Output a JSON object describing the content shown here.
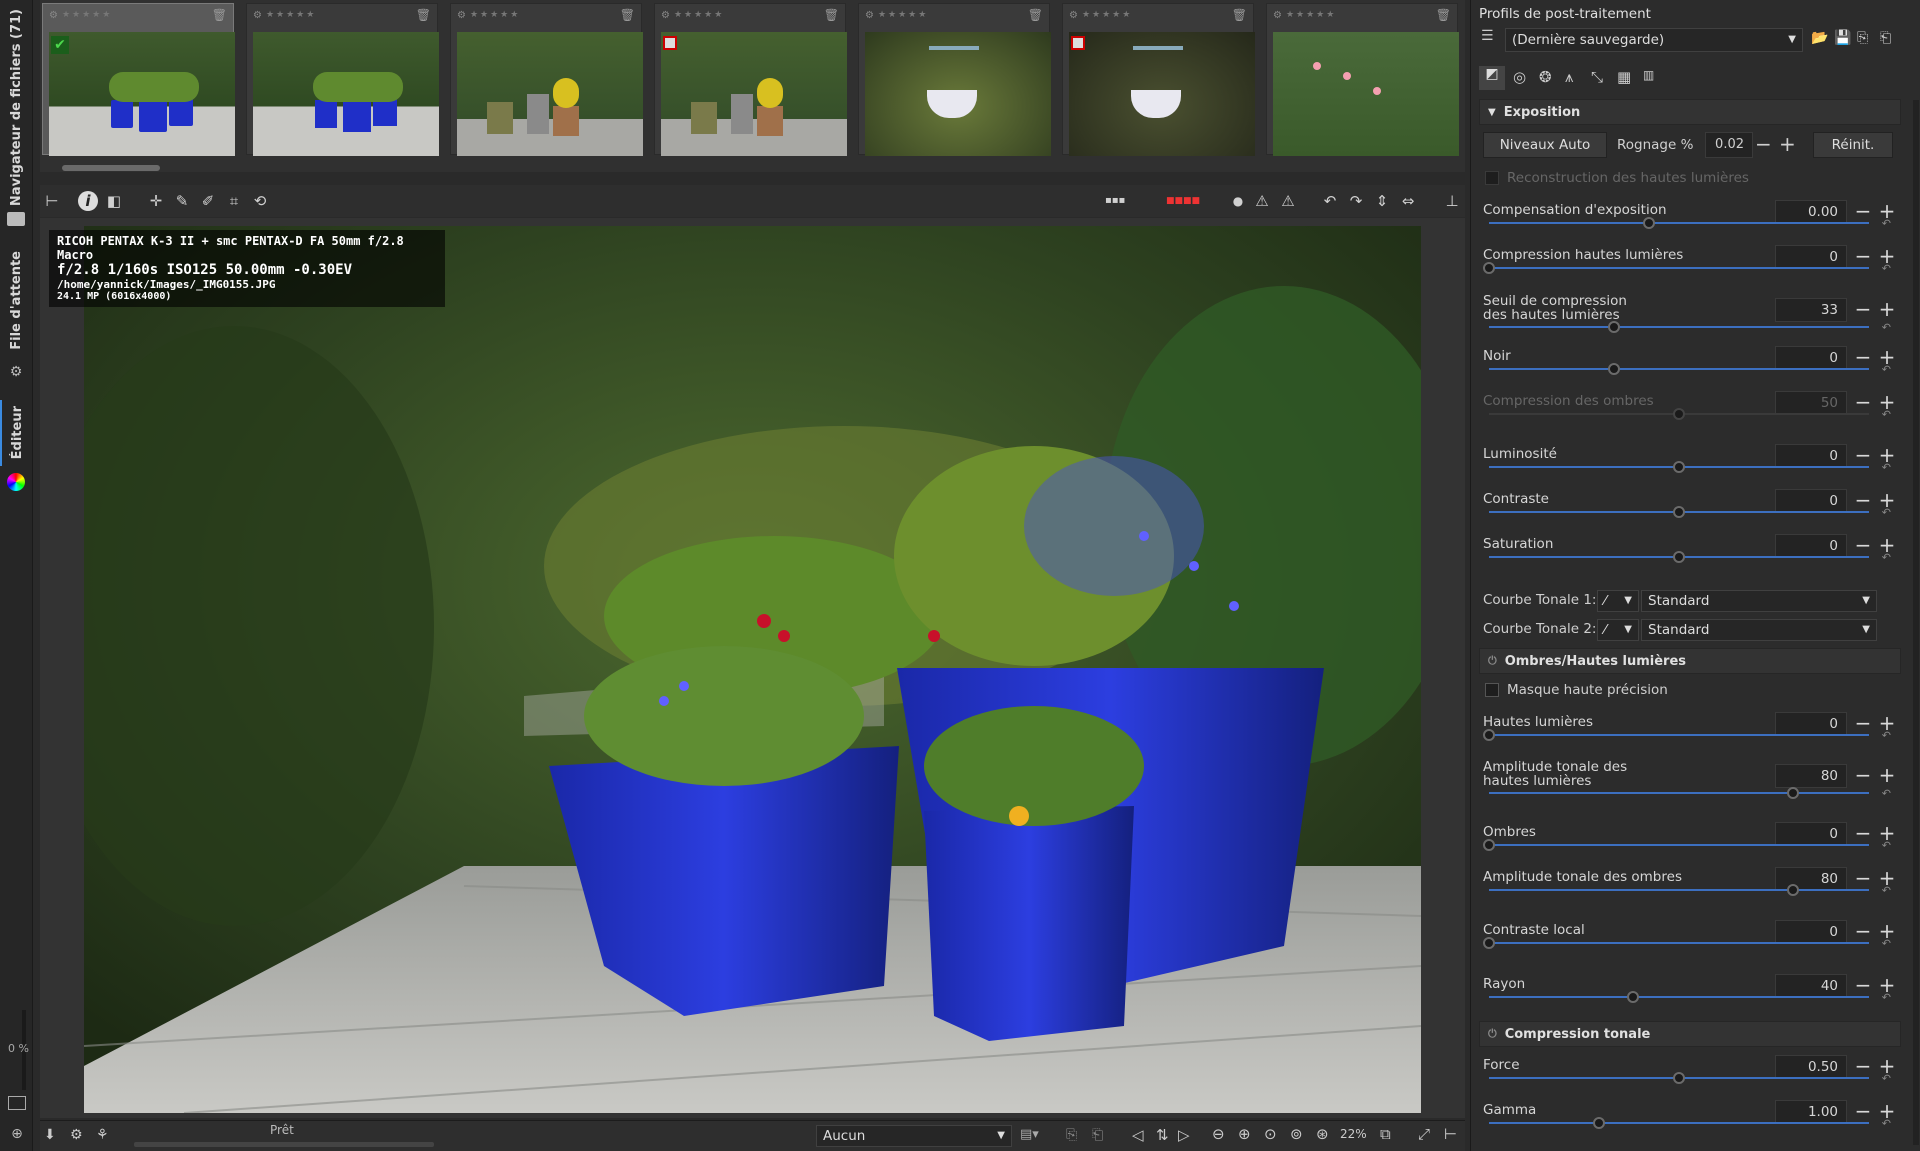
{
  "left_tabs": {
    "file_browser": "Navigateur de fichiers (71)",
    "queue": "File d'attente",
    "editor": "Éditeur",
    "zoom_percent": "0 %"
  },
  "filmstrip": {
    "thumbs": [
      {
        "name": "thumb-1",
        "saved": true,
        "selected": true
      },
      {
        "name": "thumb-2",
        "saved": false,
        "selected": false
      },
      {
        "name": "thumb-3",
        "saved": false,
        "selected": false
      },
      {
        "name": "thumb-4",
        "saved": true,
        "selected": false
      },
      {
        "name": "thumb-5",
        "saved": false,
        "selected": false
      },
      {
        "name": "thumb-6",
        "saved": true,
        "selected": false
      },
      {
        "name": "thumb-7",
        "saved": false,
        "selected": false
      }
    ],
    "stars": "★★★★★"
  },
  "exif": {
    "line1": "RICOH PENTAX K-3 II + smc PENTAX-D FA 50mm f/2.8 Macro",
    "line2": "f/2.8  1/160s  ISO125  50.00mm  -0.30EV",
    "line3": "/home/yannick/Images/_IMG0155.JPG",
    "line4": "24.1 MP (6016x4000)"
  },
  "statusbar": {
    "status": "Prêt",
    "preset": "Aucun",
    "zoom": "22%"
  },
  "profiles": {
    "title": "Profils de post-traitement",
    "selected": "(Dernière sauvegarde)"
  },
  "exposure": {
    "header": "Exposition",
    "auto_levels": "Niveaux Auto",
    "clip_label": "Rognage %",
    "clip_value": "0.02",
    "reset": "Réinit.",
    "highlight_recon": "Reconstruction des hautes lumières",
    "params": [
      {
        "label": "Compensation d'exposition",
        "value": "0.00",
        "pos": 0.42,
        "dim": false
      },
      {
        "label": "Compression hautes lumières",
        "value": "0",
        "pos": 0.0,
        "dim": false
      },
      {
        "label": "Seuil de compression",
        "label2": "des hautes lumières",
        "value": "33",
        "pos": 0.33,
        "dim": false
      },
      {
        "label": "Noir",
        "value": "0",
        "pos": 0.33,
        "dim": false
      },
      {
        "label": "Compression des ombres",
        "value": "50",
        "pos": 0.5,
        "dim": true
      },
      {
        "label": "Luminosité",
        "value": "0",
        "pos": 0.5,
        "dim": false
      },
      {
        "label": "Contraste",
        "value": "0",
        "pos": 0.5,
        "dim": false
      },
      {
        "label": "Saturation",
        "value": "0",
        "pos": 0.5,
        "dim": false
      }
    ],
    "curve1_label": "Courbe Tonale 1:",
    "curve1_value": "Standard",
    "curve2_label": "Courbe Tonale 2:",
    "curve2_value": "Standard"
  },
  "shadows_highlights": {
    "header": "Ombres/Hautes lumières",
    "hq_mask": "Masque haute précision",
    "params": [
      {
        "label": "Hautes lumières",
        "value": "0",
        "pos": 0.0
      },
      {
        "label": "Amplitude tonale des",
        "label2": "hautes lumières",
        "value": "80",
        "pos": 0.8
      },
      {
        "label": "Ombres",
        "value": "0",
        "pos": 0.0
      },
      {
        "label": "Amplitude tonale des ombres",
        "value": "80",
        "pos": 0.8
      },
      {
        "label": "Contraste local",
        "value": "0",
        "pos": 0.0
      },
      {
        "label": "Rayon",
        "value": "40",
        "pos": 0.38
      }
    ]
  },
  "tone_mapping": {
    "header": "Compression tonale",
    "params": [
      {
        "label": "Force",
        "value": "0.50",
        "pos": 0.5
      },
      {
        "label": "Gamma",
        "value": "1.00",
        "pos": 0.29
      }
    ]
  },
  "colors": {
    "accent": "#3c6fc0",
    "pot_blue": "#1f2fc8"
  }
}
